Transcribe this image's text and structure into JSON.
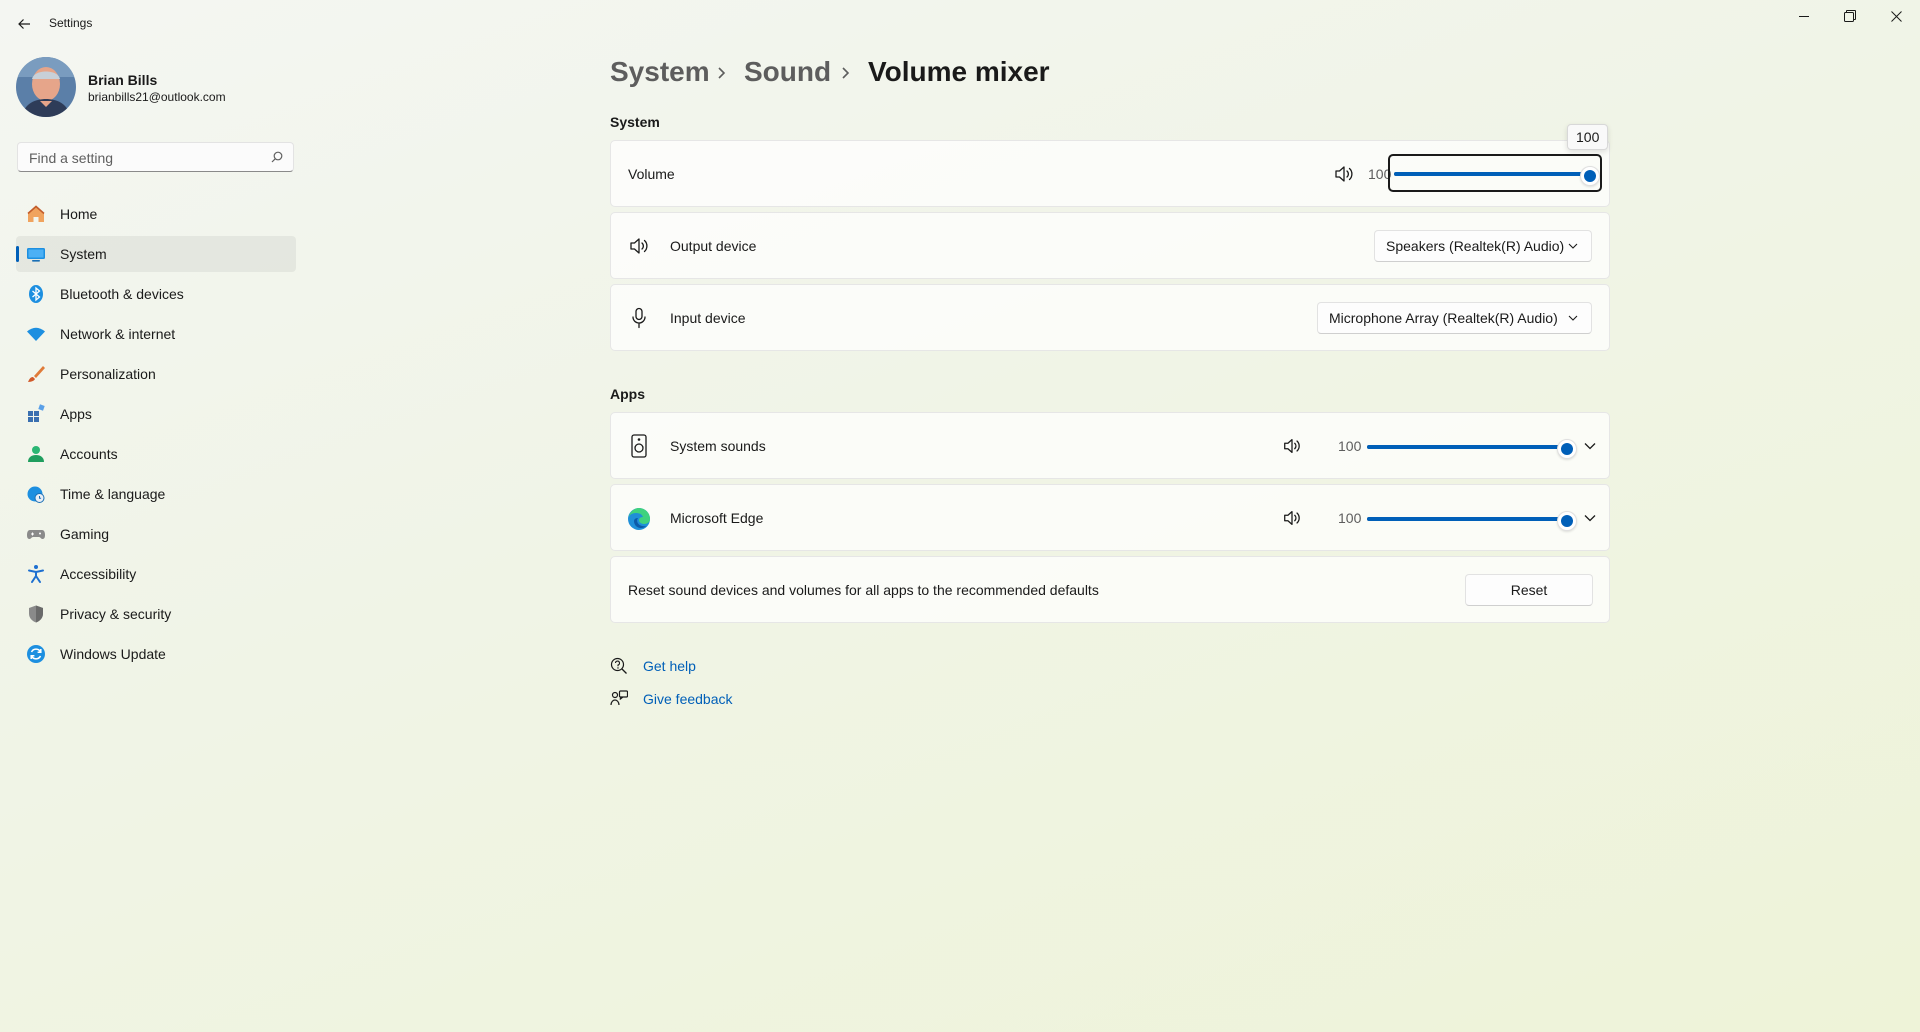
{
  "window": {
    "title": "Settings",
    "controls": {
      "minimize_icon": "minimize-icon",
      "maximize_icon": "restore-icon",
      "close_icon": "close-icon"
    }
  },
  "profile": {
    "name": "Brian Bills",
    "email": "brianbills21@outlook.com"
  },
  "search": {
    "placeholder": "Find a setting",
    "value": ""
  },
  "nav": {
    "active": "System",
    "items": [
      {
        "label": "Home",
        "icon": "home-icon",
        "color": "#e8743b"
      },
      {
        "label": "System",
        "icon": "system-icon",
        "color": "#1d8fe0"
      },
      {
        "label": "Bluetooth & devices",
        "icon": "bluetooth-icon",
        "color": "#1d8fe0"
      },
      {
        "label": "Network & internet",
        "icon": "wifi-icon",
        "color": "#1d8fe0"
      },
      {
        "label": "Personalization",
        "icon": "brush-icon",
        "color": "#e07b39"
      },
      {
        "label": "Apps",
        "icon": "apps-icon",
        "color": "#3a6fb0"
      },
      {
        "label": "Accounts",
        "icon": "accounts-icon",
        "color": "#2bb673"
      },
      {
        "label": "Time & language",
        "icon": "globe-clock-icon",
        "color": "#1d8fe0"
      },
      {
        "label": "Gaming",
        "icon": "gamepad-icon",
        "color": "#8a8a8a"
      },
      {
        "label": "Accessibility",
        "icon": "accessibility-icon",
        "color": "#1d6fd0"
      },
      {
        "label": "Privacy & security",
        "icon": "shield-icon",
        "color": "#7a7a7a"
      },
      {
        "label": "Windows Update",
        "icon": "update-icon",
        "color": "#1d8fe0"
      }
    ]
  },
  "breadcrumb": {
    "items": [
      "System",
      "Sound",
      "Volume mixer"
    ]
  },
  "system_section": {
    "heading": "System",
    "volume": {
      "label": "Volume",
      "value": "100",
      "level": 100,
      "tooltip": "100",
      "icon": "speaker-icon"
    },
    "output": {
      "label": "Output device",
      "selected": "Speakers (Realtek(R) Audio)",
      "icon": "speaker-icon"
    },
    "input": {
      "label": "Input device",
      "selected": "Microphone Array (Realtek(R) Audio)",
      "icon": "microphone-icon"
    }
  },
  "apps_section": {
    "heading": "Apps",
    "apps": [
      {
        "label": "System sounds",
        "value": "100",
        "level": 100,
        "icon": "system-sounds-icon"
      },
      {
        "label": "Microsoft Edge",
        "value": "100",
        "level": 100,
        "icon": "edge-icon"
      }
    ],
    "reset": {
      "text": "Reset sound devices and volumes for all apps to the recommended defaults",
      "button": "Reset"
    }
  },
  "help": {
    "get_help": "Get help",
    "give_feedback": "Give feedback"
  },
  "colors": {
    "accent": "#005fb8",
    "link": "#005fb8"
  }
}
